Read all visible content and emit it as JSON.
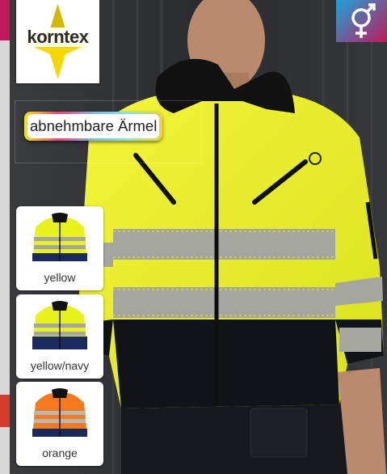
{
  "brand": {
    "name": "korntex"
  },
  "badge": {
    "icon": "unisex-gender-icon",
    "colors": [
      "#1da3d8",
      "#c2185b"
    ]
  },
  "feature": {
    "text": "abnehmbare Ärmel"
  },
  "variants": [
    {
      "label": "yellow",
      "body_color": "#e8f21c",
      "trim_color": "#1b2a5c"
    },
    {
      "label": "yellow/navy",
      "body_color": "#e8f21c",
      "trim_color": "#1b2a5c"
    },
    {
      "label": "orange",
      "body_color": "#f57a1e",
      "trim_color": "#1b2a5c"
    }
  ],
  "colors": {
    "hivis_yellow": "#eef02a",
    "navy": "#101418",
    "reflective": "#a6a6a0"
  }
}
